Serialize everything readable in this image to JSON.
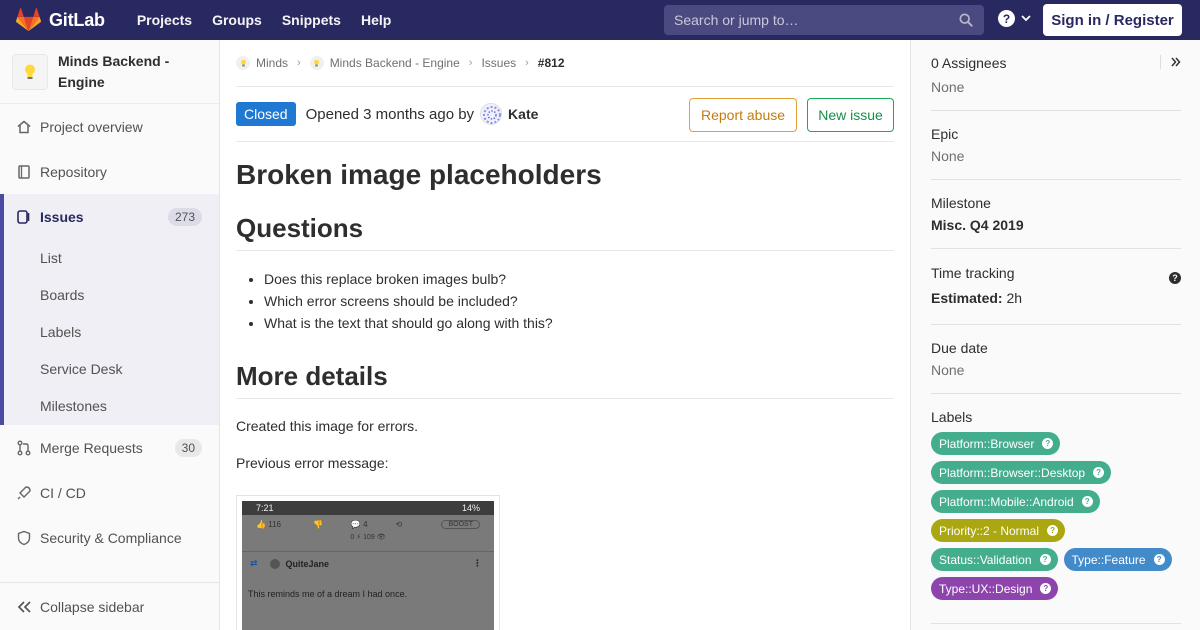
{
  "navbar": {
    "brand": "GitLab",
    "links": [
      "Projects",
      "Groups",
      "Snippets",
      "Help"
    ],
    "search_placeholder": "Search or jump to…",
    "help_icon": "?",
    "signin_label": "Sign in / Register",
    "bg_color": "#292961"
  },
  "sidebar": {
    "project_name": "Minds Backend - Engine",
    "items": {
      "overview": "Project overview",
      "repository": "Repository",
      "issues": "Issues",
      "issues_count": "273",
      "merge_requests": "Merge Requests",
      "mr_count": "30",
      "cicd": "CI / CD",
      "security": "Security & Compliance"
    },
    "sub_items": [
      "List",
      "Boards",
      "Labels",
      "Service Desk",
      "Milestones"
    ],
    "collapse_label": "Collapse sidebar"
  },
  "breadcrumb": {
    "group": "Minds",
    "project": "Minds Backend - Engine",
    "section": "Issues",
    "current": "#812"
  },
  "issue": {
    "status": "Closed",
    "opened_prefix": "Opened 3 months ago by",
    "author": "Kate",
    "report_abuse": "Report abuse",
    "new_issue": "New issue",
    "title": "Broken image placeholders",
    "questions_heading": "Questions",
    "questions": [
      "Does this replace broken images bulb?",
      "Which error screens should be included?",
      "What is the text that should go along with this?"
    ],
    "details_heading": "More details",
    "details_text": "Created this image for errors.",
    "previous_text": "Previous error message:",
    "screenshot": {
      "time": "7:21",
      "battery": "14%",
      "likes": "116",
      "comments": "4",
      "boost": "BOOST",
      "views": "0 ⚡ 109 👁",
      "user": "QuiteJane",
      "post_text": "This reminds me of a dream I had once."
    }
  },
  "right_sidebar": {
    "assignees_title": "0 Assignees",
    "assignees_value": "None",
    "epic_title": "Epic",
    "epic_value": "None",
    "milestone_title": "Milestone",
    "milestone_value": "Misc. Q4 2019",
    "time_title": "Time tracking",
    "time_estimated_label": "Estimated:",
    "time_estimated_value": "2h",
    "due_title": "Due date",
    "due_value": "None",
    "labels_title": "Labels",
    "labels": [
      {
        "text": "Platform::Browser",
        "color": "#44ad8e"
      },
      {
        "text": "Platform::Browser::Desktop",
        "color": "#44ad8e"
      },
      {
        "text": "Platform::Mobile::Android",
        "color": "#44ad8e"
      },
      {
        "text": "Priority::2 - Normal",
        "color": "#aaa710"
      },
      {
        "text": "Status::Validation",
        "color": "#44ad8e"
      },
      {
        "text": "Type::Feature",
        "color": "#428bca"
      },
      {
        "text": "Type::UX::Design",
        "color": "#8e44ad"
      }
    ]
  }
}
